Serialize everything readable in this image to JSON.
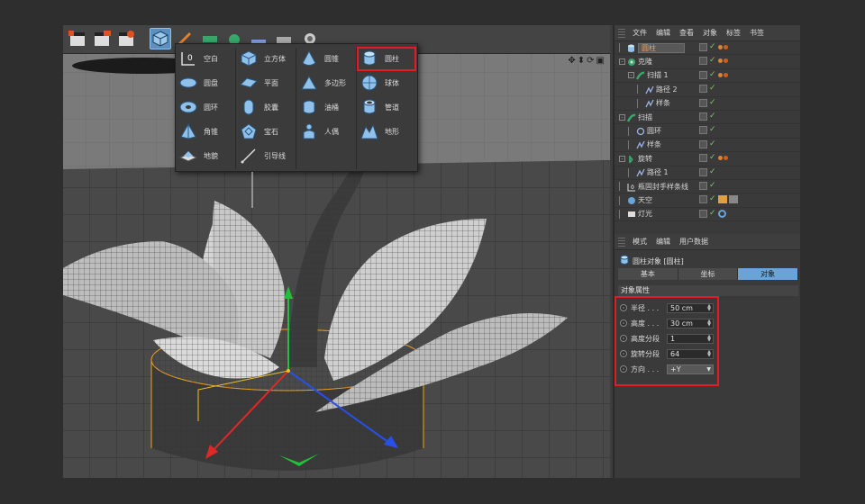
{
  "object_manager": {
    "menu": [
      "文件",
      "编辑",
      "查看",
      "对象",
      "标签",
      "书签"
    ],
    "rows": [
      {
        "label": "圆柱",
        "indent": 0,
        "icon": "cylinder",
        "selected": true,
        "tags": 1,
        "expander": ""
      },
      {
        "label": "克隆",
        "indent": 0,
        "icon": "cloner",
        "selected": false,
        "tags": 1,
        "expander": "-"
      },
      {
        "label": "扫描 1",
        "indent": 1,
        "icon": "sweep",
        "selected": false,
        "tags": 1,
        "expander": "-"
      },
      {
        "label": "路径 2",
        "indent": 2,
        "icon": "spline",
        "selected": false,
        "tags": 0,
        "expander": ""
      },
      {
        "label": "样条",
        "indent": 2,
        "icon": "spline",
        "selected": false,
        "tags": 0,
        "expander": ""
      },
      {
        "label": "扫描",
        "indent": 0,
        "icon": "sweep",
        "selected": false,
        "tags": 0,
        "expander": "-"
      },
      {
        "label": "圆环",
        "indent": 1,
        "icon": "circle",
        "selected": false,
        "tags": 0,
        "expander": ""
      },
      {
        "label": "样条",
        "indent": 1,
        "icon": "spline",
        "selected": false,
        "tags": 0,
        "expander": ""
      },
      {
        "label": "旋转",
        "indent": 0,
        "icon": "lathe",
        "selected": false,
        "tags": 1,
        "expander": "-"
      },
      {
        "label": "路径 1",
        "indent": 1,
        "icon": "spline",
        "selected": false,
        "tags": 0,
        "expander": ""
      },
      {
        "label": "瓶固封手样条线",
        "indent": 0,
        "icon": "null",
        "selected": false,
        "tags": 0,
        "expander": ""
      },
      {
        "label": "天空",
        "indent": 0,
        "icon": "sky",
        "selected": false,
        "tags": 2,
        "expander": ""
      },
      {
        "label": "灯光",
        "indent": 0,
        "icon": "light",
        "selected": false,
        "tags": 3,
        "expander": ""
      }
    ]
  },
  "attributes": {
    "menu": [
      "模式",
      "编辑",
      "用户数据"
    ],
    "title": "圆柱对象 [圆柱]",
    "tabs": [
      {
        "label": "基本",
        "active": false
      },
      {
        "label": "坐标",
        "active": false
      },
      {
        "label": "对象",
        "active": true
      }
    ],
    "section": "对象属性",
    "fields": [
      {
        "label": "半径 . . .",
        "value": "50 cm",
        "type": "number"
      },
      {
        "label": "高度 . . .",
        "value": "30 cm",
        "type": "number"
      },
      {
        "label": "高度分段",
        "value": "1",
        "type": "number"
      },
      {
        "label": "旋转分段",
        "value": "64",
        "type": "number"
      },
      {
        "label": "方向 . . .",
        "value": "+Y",
        "type": "select"
      }
    ]
  },
  "primitives_menu": {
    "columns": [
      [
        {
          "label": "空白",
          "icon": "null-icon"
        },
        {
          "label": "圆盘",
          "icon": "disc-icon"
        },
        {
          "label": "圆环",
          "icon": "torus-icon"
        },
        {
          "label": "角锥",
          "icon": "pyramid-icon"
        },
        {
          "label": "地貌",
          "icon": "landscape-icon"
        }
      ],
      [
        {
          "label": "立方体",
          "icon": "cube-icon"
        },
        {
          "label": "平面",
          "icon": "plane-icon"
        },
        {
          "label": "胶囊",
          "icon": "capsule-icon"
        },
        {
          "label": "宝石",
          "icon": "gem-icon"
        },
        {
          "label": "引导线",
          "icon": "guide-icon"
        }
      ],
      [
        {
          "label": "圆锥",
          "icon": "cone-icon"
        },
        {
          "label": "多边形",
          "icon": "polygon-icon"
        },
        {
          "label": "油桶",
          "icon": "oiltank-icon"
        },
        {
          "label": "人偶",
          "icon": "figure-icon"
        }
      ],
      [
        {
          "label": "圆柱",
          "icon": "cylinder-icon",
          "highlighted": true
        },
        {
          "label": "球体",
          "icon": "sphere-icon"
        },
        {
          "label": "管道",
          "icon": "tube-icon"
        },
        {
          "label": "地形",
          "icon": "terrain-icon"
        }
      ]
    ]
  },
  "colors": {
    "highlight": "#e21b24",
    "accent": "#6aa3d8",
    "selected_text": "#f0a060"
  }
}
